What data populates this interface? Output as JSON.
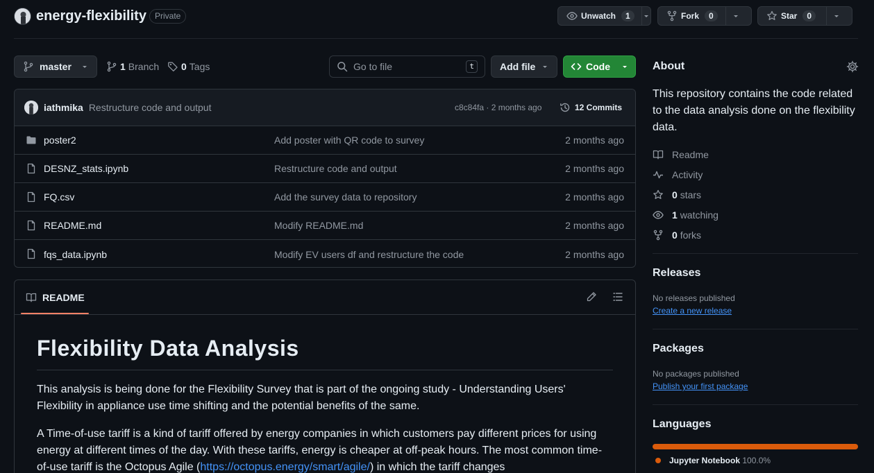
{
  "repo": {
    "name": "energy-flexibility",
    "visibility": "Private"
  },
  "header_buttons": {
    "watch": {
      "label": "Unwatch",
      "count": "1"
    },
    "fork": {
      "label": "Fork",
      "count": "0"
    },
    "star": {
      "label": "Star",
      "count": "0"
    }
  },
  "toolbar": {
    "branch": "master",
    "branches_count": "1",
    "branches_label": "Branch",
    "tags_count": "0",
    "tags_label": "Tags",
    "go_to_file_placeholder": "Go to file",
    "go_to_file_key": "t",
    "add_file": "Add file",
    "code": "Code"
  },
  "latest_commit": {
    "user": "iathmika",
    "message": "Restructure code and output",
    "meta": "c8c84fa · 2 months ago",
    "commits": "12 Commits"
  },
  "files": [
    {
      "type": "folder",
      "name": "poster2",
      "commit": "Add poster with QR code to survey",
      "date": "2 months ago"
    },
    {
      "type": "file",
      "name": "DESNZ_stats.ipynb",
      "commit": "Restructure code and output",
      "date": "2 months ago"
    },
    {
      "type": "file",
      "name": "FQ.csv",
      "commit": "Add the survey data to repository",
      "date": "2 months ago"
    },
    {
      "type": "file",
      "name": "README.md",
      "commit": "Modify README.md",
      "date": "2 months ago"
    },
    {
      "type": "file",
      "name": "fqs_data.ipynb",
      "commit": "Modify EV users df and restructure the code",
      "date": "2 months ago"
    }
  ],
  "readme": {
    "tab": "README",
    "title": "Flexibility Data Analysis",
    "p1": "This analysis is being done for the Flexibility Survey that is part of the ongoing study - Understanding Users' Flexibility in appliance use time shifting and the potential benefits of the same.",
    "p2_before": "A Time-of-use tariff is a kind of tariff offered by energy companies in which customers pay different prices for using energy at different times of the day. With these tariffs, energy is cheaper at off-peak hours. The most common time-of-use tariff is the Octopus Agile (",
    "p2_link": "https://octopus.energy/smart/agile/",
    "p2_after": ") in which the tariff changes"
  },
  "about": {
    "title": "About",
    "description": "This repository contains the code related to the data analysis done on the flexibility data.",
    "links": {
      "readme": "Readme",
      "activity": "Activity",
      "stars_count": "0",
      "stars_label": "stars",
      "watching_count": "1",
      "watching_label": "watching",
      "forks_count": "0",
      "forks_label": "forks"
    }
  },
  "releases": {
    "title": "Releases",
    "empty": "No releases published",
    "link": "Create a new release"
  },
  "packages": {
    "title": "Packages",
    "empty": "No packages published",
    "link": "Publish your first package"
  },
  "languages": {
    "title": "Languages",
    "items": [
      {
        "name": "Jupyter Notebook",
        "percent": "100.0%",
        "color": "#DA5B0B"
      }
    ]
  },
  "colors": {
    "accent_green": "#238636",
    "link_blue": "#4493f8",
    "underline_orange": "#f78166"
  }
}
